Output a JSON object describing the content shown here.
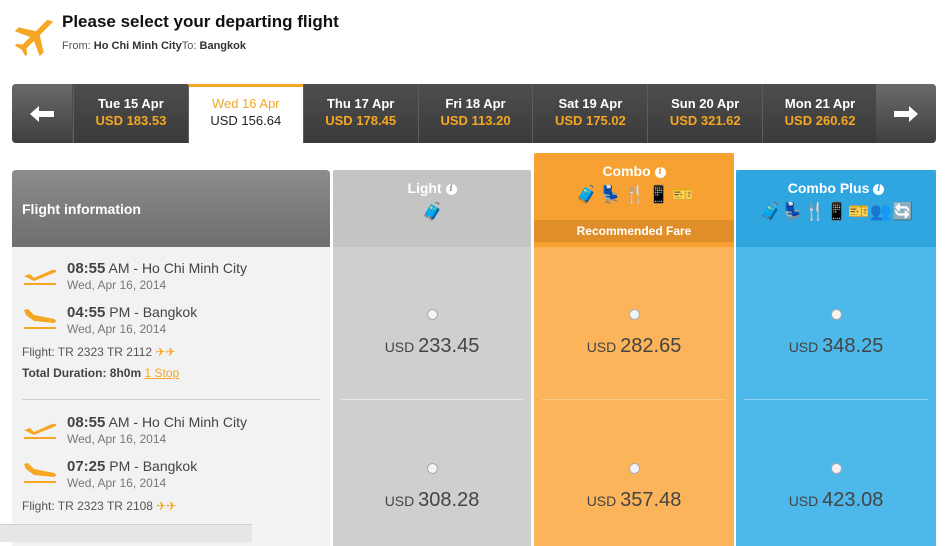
{
  "header": {
    "title": "Please select your departing flight",
    "from_label": "From: ",
    "from_city": "Ho Chi Minh City",
    "to_label": "To: ",
    "to_city": "Bangkok"
  },
  "dates": [
    {
      "day": "Tue 15 Apr",
      "price": "USD 183.53"
    },
    {
      "day": "Wed 16 Apr",
      "price": "USD 156.64"
    },
    {
      "day": "Thu 17 Apr",
      "price": "USD 178.45"
    },
    {
      "day": "Fri 18 Apr",
      "price": "USD 113.20"
    },
    {
      "day": "Sat 19 Apr",
      "price": "USD 175.02"
    },
    {
      "day": "Sun 20 Apr",
      "price": "USD 321.62"
    },
    {
      "day": "Mon 21 Apr",
      "price": "USD 260.62"
    }
  ],
  "columns": {
    "info": "Flight information",
    "light": "Light",
    "combo": "Combo",
    "combo_plus": "Combo Plus",
    "recommended": "Recommended Fare"
  },
  "flights": [
    {
      "dep_time": "08:55",
      "dep_ampm": "AM",
      "dep_city": "- Ho Chi Minh City",
      "dep_date": "Wed, Apr 16, 2014",
      "arr_time": "04:55",
      "arr_ampm": "PM",
      "arr_city": "- Bangkok",
      "arr_date": "Wed, Apr 16, 2014",
      "flight_label": "Flight: ",
      "flight_no": "TR 2323 TR 2112",
      "duration_label": "Total Duration: 8h0m",
      "stops": "1 Stop",
      "light_price": "233.45",
      "combo_price": "282.65",
      "plus_price": "348.25"
    },
    {
      "dep_time": "08:55",
      "dep_ampm": "AM",
      "dep_city": "- Ho Chi Minh City",
      "dep_date": "Wed, Apr 16, 2014",
      "arr_time": "07:25",
      "arr_ampm": "PM",
      "arr_city": "- Bangkok",
      "arr_date": "Wed, Apr 16, 2014",
      "flight_label": "Flight: ",
      "flight_no": "TR 2323 TR 2108",
      "light_price": "308.28",
      "combo_price": "357.48",
      "plus_price": "423.08"
    }
  ],
  "currency": "USD",
  "info_icon_glyph": "i",
  "colors": {
    "accent": "#f5a623",
    "light": "#cfcfcf",
    "combo": "#fbb45a",
    "combo_plus": "#4db8ea"
  }
}
